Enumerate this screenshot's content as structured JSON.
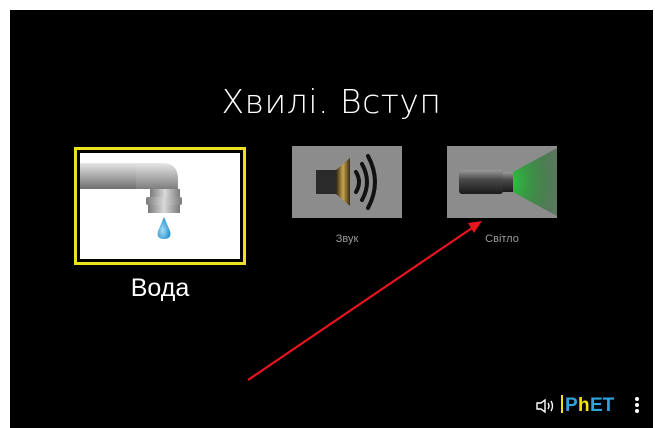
{
  "title": "Хвилі. Вступ",
  "screens": {
    "water": {
      "label": "Вода",
      "selected": true,
      "icon": "faucet-icon"
    },
    "sound": {
      "label": "Звук",
      "selected": false,
      "icon": "speaker-icon"
    },
    "light": {
      "label": "Світло",
      "selected": false,
      "icon": "flashlight-icon"
    }
  },
  "navbar": {
    "brand": "PhET",
    "sound_icon": "speaker-volume-icon",
    "menu_icon": "vertical-dots-icon"
  },
  "colors": {
    "background": "#000000",
    "selected_border": "#ece221",
    "thumb_gray": "#8c8c8c",
    "water_drop": "#3ea3dc",
    "light_beam": "#1e8a2e",
    "arrow": "#e8141e",
    "phet_blue": "#2ea3dc",
    "phet_yellow": "#f3e500"
  }
}
